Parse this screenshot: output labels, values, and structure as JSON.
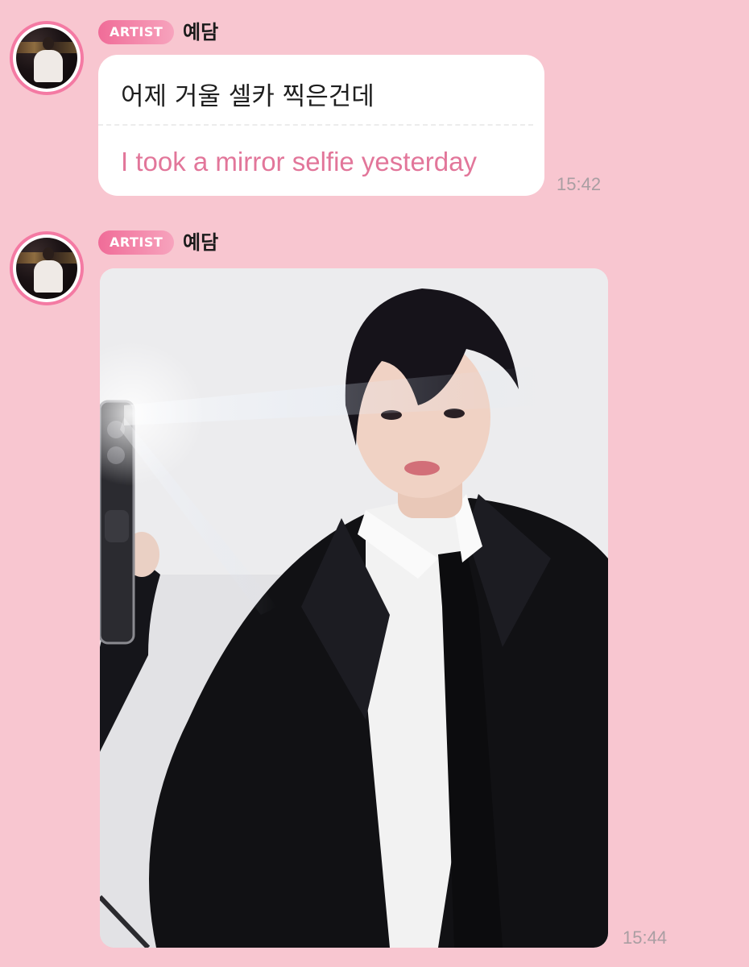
{
  "messages": [
    {
      "badge": "ARTIST",
      "sender": "예담",
      "text_ko": "어제 거울 셀카 찍은건데",
      "text_en": "I took a mirror selfie yesterday",
      "time": "15:42"
    },
    {
      "badge": "ARTIST",
      "sender": "예담",
      "image_alt": "mirror selfie photo",
      "time": "15:44"
    }
  ],
  "colors": {
    "background": "#f8c6d0",
    "badge_start": "#f06c98",
    "badge_end": "#f7a3bd",
    "translation_text": "#e2769a",
    "timestamp": "#a99ea2",
    "avatar_ring": "#f47aa3"
  }
}
